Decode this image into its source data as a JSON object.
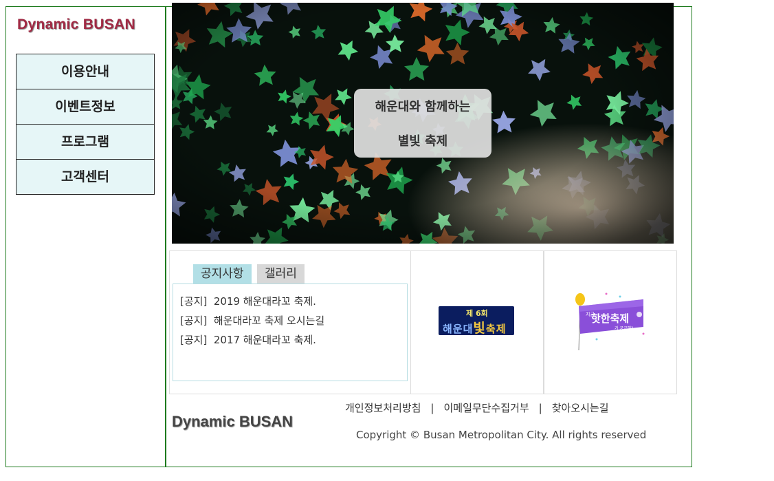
{
  "brand": {
    "logo_text": "Dynamic BUSAN"
  },
  "menu": {
    "items": [
      {
        "label": "이용안내"
      },
      {
        "label": "이벤트정보"
      },
      {
        "label": "프로그램"
      },
      {
        "label": "고객센터"
      }
    ]
  },
  "hero": {
    "line1": "해운대와 함께하는",
    "line2": "별빛 축제"
  },
  "notice": {
    "tabs": [
      {
        "label": "공지사항"
      },
      {
        "label": "갤러리"
      }
    ],
    "items": [
      {
        "tag": "[공지]",
        "title": "2019 해운대라꼬 축제."
      },
      {
        "tag": "[공지]",
        "title": "해운대라꼬 축제 오시는길"
      },
      {
        "tag": "[공지]",
        "title": "2017 해운대라꼬 축제."
      }
    ]
  },
  "banners": {
    "festival": {
      "sub": "제 6회",
      "main_prefix": "해운대",
      "main_highlight": "빛",
      "main_suffix": "축제"
    },
    "event": {
      "main": "핫한축제",
      "small_top": "지금",
      "small_bottom": "가 궁금해?"
    }
  },
  "footer": {
    "links": [
      {
        "label": "개인정보처리방침"
      },
      {
        "label": "이메일무단수집거부"
      },
      {
        "label": "찾아오시는길"
      }
    ],
    "separator": "|",
    "logo_text": "Dynamic BUSAN",
    "copyright": "Copyright © Busan Metropolitan City. All rights reserved"
  }
}
